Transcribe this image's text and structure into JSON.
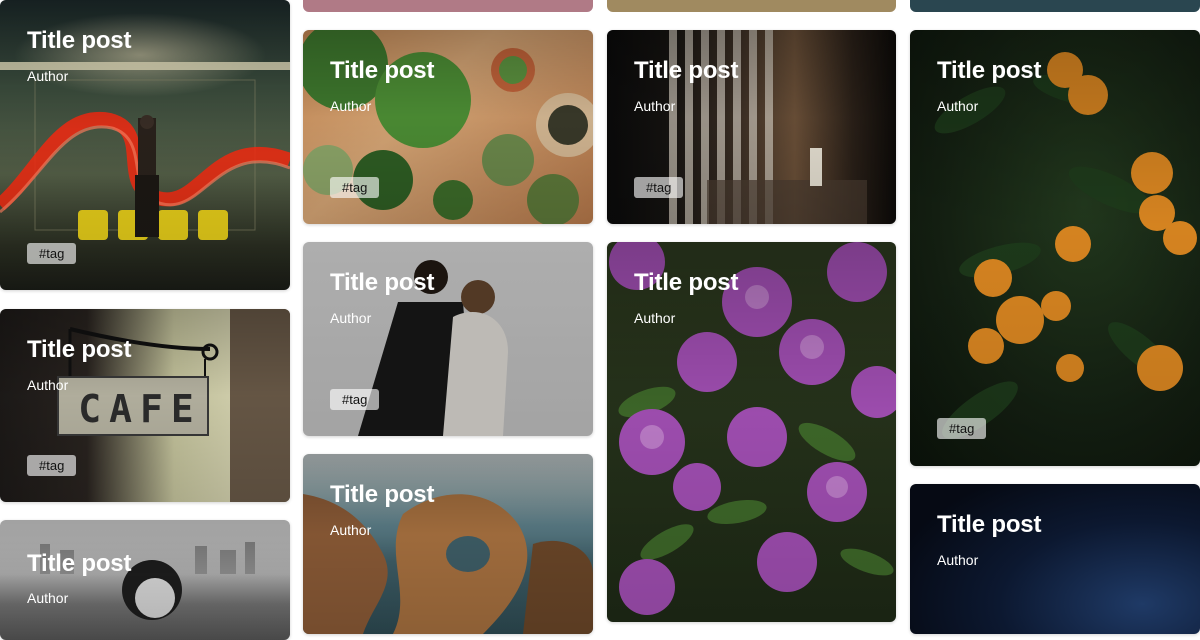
{
  "cards": {
    "neon": {
      "title": "Title post",
      "author": "Author",
      "tag": "#tag"
    },
    "plants": {
      "title": "Title post",
      "author": "Author",
      "tag": "#tag"
    },
    "window": {
      "title": "Title post",
      "author": "Author",
      "tag": "#tag"
    },
    "oranges": {
      "title": "Title post",
      "author": "Author",
      "tag": "#tag"
    },
    "cafe": {
      "title": "Title post",
      "author": "Author",
      "tag": "#tag",
      "sign_text": "CAFE"
    },
    "couple": {
      "title": "Title post",
      "author": "Author",
      "tag": "#tag"
    },
    "flowers": {
      "title": "Title post",
      "author": "Author"
    },
    "portrait": {
      "title": "Title post",
      "author": "Author"
    },
    "coast": {
      "title": "Title post",
      "author": "Author"
    },
    "night": {
      "title": "Title post",
      "author": "Author"
    }
  }
}
